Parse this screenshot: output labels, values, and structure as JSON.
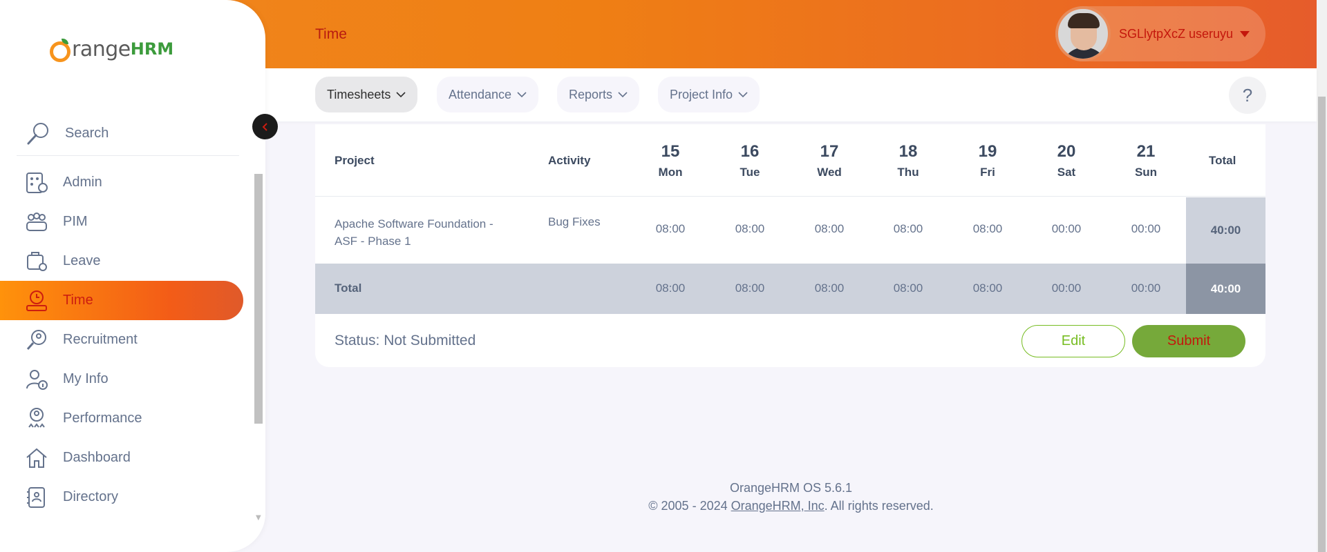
{
  "brand": {
    "name_part": "range",
    "hrm_part": "HRM"
  },
  "sidebar": {
    "search_placeholder": "Search",
    "items": [
      {
        "label": "Admin",
        "icon": "admin-icon"
      },
      {
        "label": "PIM",
        "icon": "pim-icon"
      },
      {
        "label": "Leave",
        "icon": "leave-icon"
      },
      {
        "label": "Time",
        "icon": "time-icon",
        "active": true
      },
      {
        "label": "Recruitment",
        "icon": "recruitment-icon"
      },
      {
        "label": "My Info",
        "icon": "my-info-icon"
      },
      {
        "label": "Performance",
        "icon": "performance-icon"
      },
      {
        "label": "Dashboard",
        "icon": "dashboard-icon"
      },
      {
        "label": "Directory",
        "icon": "directory-icon"
      }
    ]
  },
  "header": {
    "page_title": "Time",
    "user_name": "SGLlytpXcZ useruyu"
  },
  "nav": {
    "tabs": [
      {
        "label": "Timesheets",
        "active": true
      },
      {
        "label": "Attendance"
      },
      {
        "label": "Reports"
      },
      {
        "label": "Project Info"
      }
    ],
    "help_label": "?"
  },
  "timesheet": {
    "col_project": "Project",
    "col_activity": "Activity",
    "col_total": "Total",
    "days": [
      {
        "num": "15",
        "name": "Mon"
      },
      {
        "num": "16",
        "name": "Tue"
      },
      {
        "num": "17",
        "name": "Wed"
      },
      {
        "num": "18",
        "name": "Thu"
      },
      {
        "num": "19",
        "name": "Fri"
      },
      {
        "num": "20",
        "name": "Sat"
      },
      {
        "num": "21",
        "name": "Sun"
      }
    ],
    "rows": [
      {
        "project_line1": "Apache Software Foundation -",
        "project_line2": "ASF - Phase 1",
        "activity": "Bug Fixes",
        "hours": [
          "08:00",
          "08:00",
          "08:00",
          "08:00",
          "08:00",
          "00:00",
          "00:00"
        ],
        "total": "40:00"
      }
    ],
    "total_row": {
      "label": "Total",
      "hours": [
        "08:00",
        "08:00",
        "08:00",
        "08:00",
        "08:00",
        "00:00",
        "00:00"
      ],
      "grand_total": "40:00"
    },
    "status_text": "Status: Not Submitted",
    "edit_label": "Edit",
    "submit_label": "Submit"
  },
  "footer": {
    "version": "OrangeHRM OS 5.6.1",
    "copyright_prefix": "© 2005 - 2024 ",
    "company_link": "OrangeHRM, Inc",
    "copyright_suffix": ". All rights reserved."
  },
  "colors": {
    "brand_orange": "#ef7f14",
    "active_text": "#cc1d10",
    "submit_green": "#76a93a",
    "muted_text": "#64728c"
  }
}
